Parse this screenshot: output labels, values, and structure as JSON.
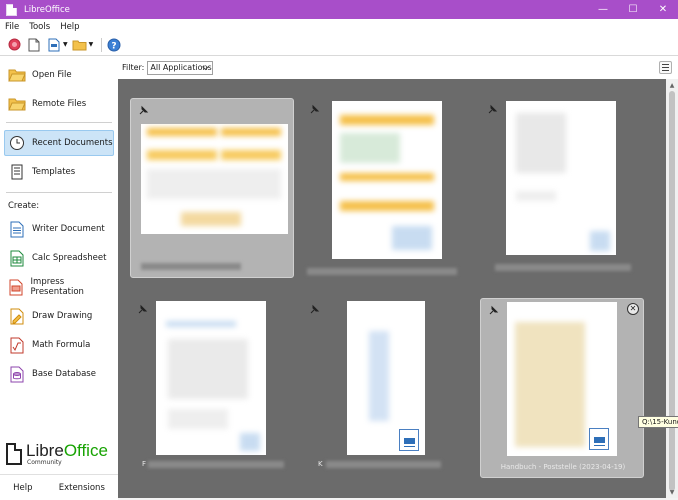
{
  "window": {
    "title": "LibreOffice",
    "minimize": "—",
    "maximize": "☐",
    "close": "✕"
  },
  "menu": [
    "File",
    "Tools",
    "Help"
  ],
  "sidebar": {
    "open_file": "Open File",
    "remote_files": "Remote Files",
    "recent_documents": "Recent Documents",
    "templates": "Templates",
    "create_label": "Create:",
    "writer": "Writer Document",
    "calc": "Calc Spreadsheet",
    "impress": "Impress Presentation",
    "draw": "Draw Drawing",
    "math": "Math Formula",
    "base": "Base Database",
    "help": "Help",
    "extensions": "Extensions"
  },
  "logo": {
    "brand_a": "Libre",
    "brand_b": "Office",
    "community": "Community"
  },
  "filter": {
    "label": "Filter:",
    "value": "All Applications"
  },
  "recent": {
    "card6_caption": "Handbuch - Poststelle (2023-04-19)",
    "card4_caption_prefix": "F",
    "card5_caption_prefix": "K"
  },
  "tooltip": "Q:\\15-Kund",
  "colors": {
    "titlebar": "#a84ec9",
    "grid_bg": "#6b6b6b",
    "active_item": "#cce4f7",
    "logo_green": "#18a303"
  }
}
